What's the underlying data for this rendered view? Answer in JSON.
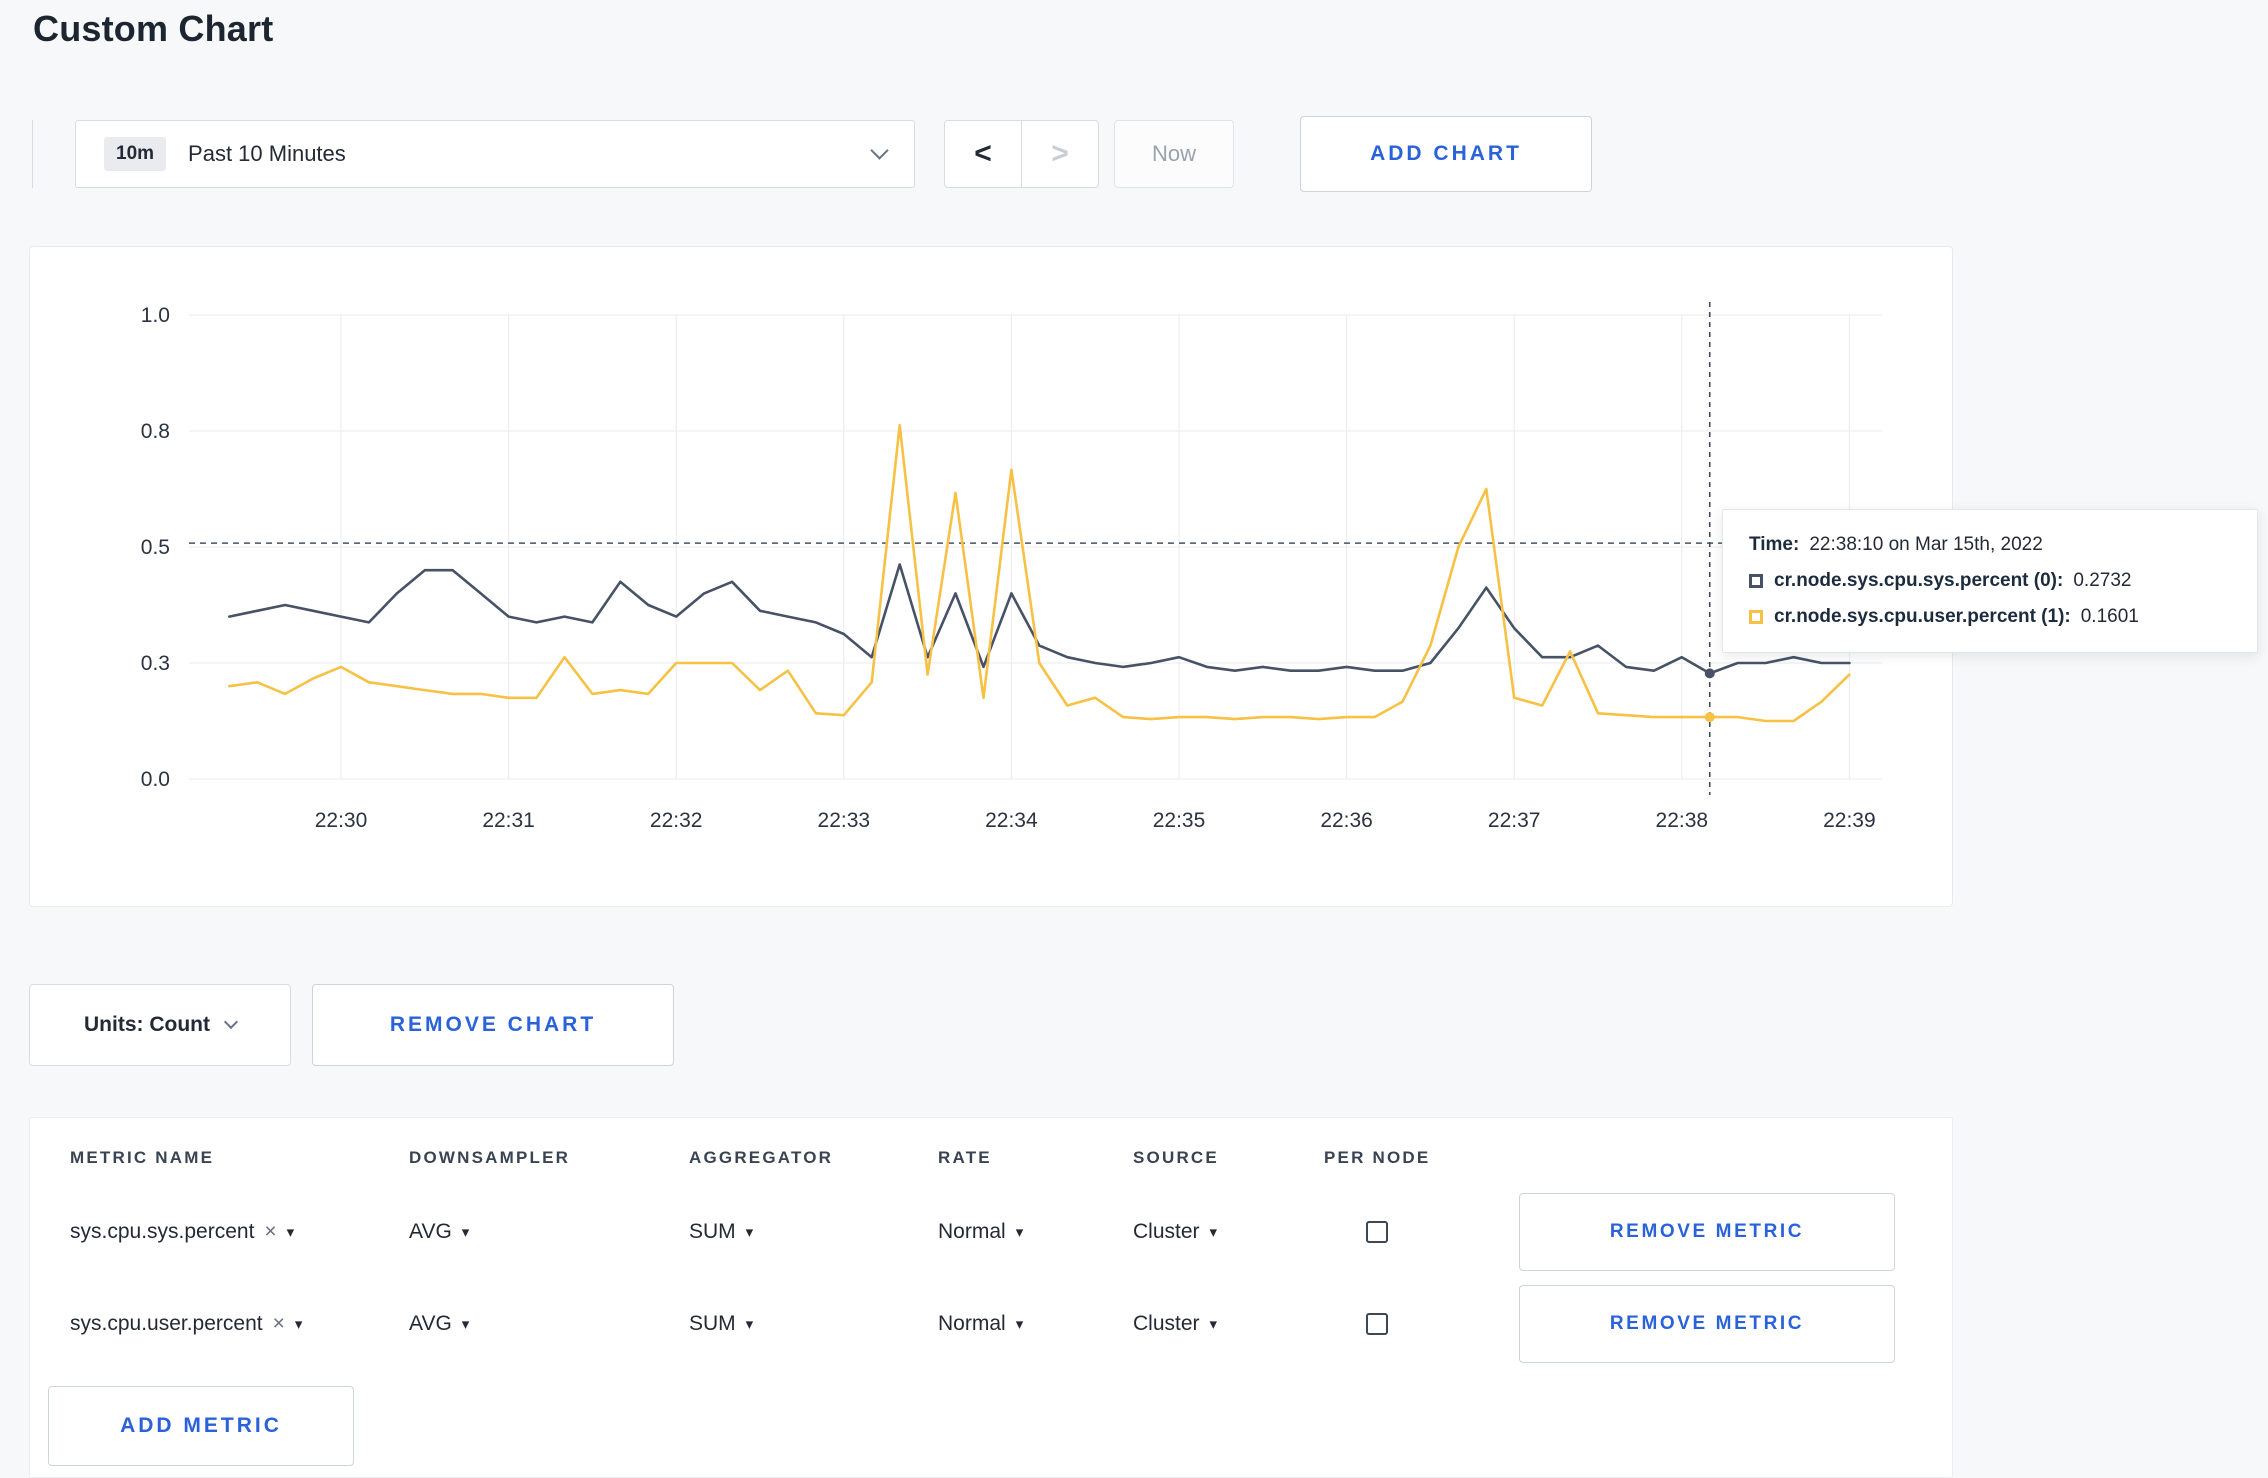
{
  "page": {
    "title": "Custom Chart"
  },
  "accent_color": "#2962d9",
  "icons": {
    "chevron_left": "<",
    "chevron_right": ">",
    "caret_down": "▾",
    "close": "×"
  },
  "toolbar": {
    "range_badge": "10m",
    "range_label": "Past 10 Minutes",
    "now_label": "Now",
    "add_chart_label": "ADD CHART"
  },
  "chart_controls": {
    "units_label": "Units: Count",
    "remove_chart_label": "REMOVE CHART"
  },
  "tooltip": {
    "time_label": "Time:",
    "time_value": "22:38:10 on Mar 15th, 2022",
    "series1_label": "cr.node.sys.cpu.sys.percent (0):",
    "series1_value": "0.2732",
    "series2_label": "cr.node.sys.cpu.user.percent (1):",
    "series2_value": "0.1601"
  },
  "chart_data": {
    "type": "line",
    "title": "",
    "x_tick_labels": [
      "22:30",
      "22:31",
      "22:32",
      "22:33",
      "22:34",
      "22:35",
      "22:36",
      "22:37",
      "22:38",
      "22:39"
    ],
    "y_ticks": [
      0.0,
      0.3,
      0.5,
      0.8,
      1.0
    ],
    "y_tick_labels": [
      "0.0",
      "0.3",
      "0.5",
      "0.8",
      "1.0"
    ],
    "x_start_offset_minutes": -0.6667,
    "x_step_minutes": 0.16667,
    "grid": true,
    "series": [
      {
        "name": "cr.node.sys.cpu.sys.percent",
        "color": "#475266",
        "values": [
          0.38,
          0.39,
          0.4,
          0.39,
          0.38,
          0.37,
          0.42,
          0.46,
          0.46,
          0.42,
          0.38,
          0.37,
          0.38,
          0.37,
          0.44,
          0.4,
          0.38,
          0.42,
          0.44,
          0.39,
          0.38,
          0.37,
          0.35,
          0.31,
          0.47,
          0.31,
          0.42,
          0.29,
          0.42,
          0.33,
          0.31,
          0.3,
          0.29,
          0.3,
          0.31,
          0.29,
          0.28,
          0.29,
          0.28,
          0.28,
          0.29,
          0.28,
          0.28,
          0.3,
          0.36,
          0.43,
          0.36,
          0.31,
          0.31,
          0.33,
          0.29,
          0.28,
          0.31,
          0.2732,
          0.3,
          0.3,
          0.31,
          0.3,
          0.3
        ]
      },
      {
        "name": "cr.node.sys.cpu.user.percent",
        "color": "#f6c144",
        "values": [
          0.24,
          0.25,
          0.22,
          0.26,
          0.29,
          0.25,
          0.24,
          0.23,
          0.22,
          0.22,
          0.21,
          0.21,
          0.31,
          0.22,
          0.23,
          0.22,
          0.3,
          0.3,
          0.3,
          0.23,
          0.28,
          0.17,
          0.165,
          0.25,
          0.81,
          0.27,
          0.64,
          0.21,
          0.7,
          0.3,
          0.19,
          0.21,
          0.16,
          0.155,
          0.16,
          0.16,
          0.155,
          0.16,
          0.16,
          0.155,
          0.16,
          0.16,
          0.2,
          0.33,
          0.5,
          0.65,
          0.21,
          0.19,
          0.32,
          0.17,
          0.165,
          0.16,
          0.16,
          0.1601,
          0.16,
          0.15,
          0.15,
          0.2,
          0.27
        ]
      }
    ],
    "threshold_line": {
      "value": 0.51,
      "style": "dashed",
      "color": "#475266"
    },
    "crosshair": {
      "x_offset_minutes": 8.1667,
      "time_label": "22:38:10 on Mar 15th, 2022",
      "points": [
        {
          "series": 0,
          "value": 0.2732
        },
        {
          "series": 1,
          "value": 0.1601
        }
      ]
    },
    "legend_position": "tooltip",
    "ylim": [
      0,
      1.0
    ]
  },
  "metrics_table": {
    "headers": [
      "METRIC NAME",
      "DOWNSAMPLER",
      "AGGREGATOR",
      "RATE",
      "SOURCE",
      "PER NODE"
    ],
    "rows": [
      {
        "metric": "sys.cpu.sys.percent",
        "downsampler": "AVG",
        "aggregator": "SUM",
        "rate": "Normal",
        "source": "Cluster",
        "per_node": false,
        "remove_label": "REMOVE METRIC"
      },
      {
        "metric": "sys.cpu.user.percent",
        "downsampler": "AVG",
        "aggregator": "SUM",
        "rate": "Normal",
        "source": "Cluster",
        "per_node": false,
        "remove_label": "REMOVE METRIC"
      }
    ],
    "add_metric_label": "ADD METRIC"
  }
}
